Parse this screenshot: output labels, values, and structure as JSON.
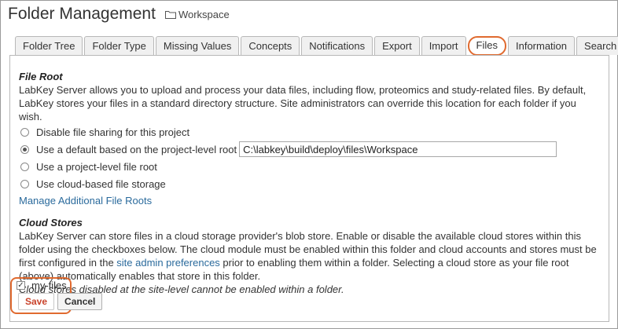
{
  "header": {
    "title": "Folder Management",
    "folder": "Workspace"
  },
  "tabs": [
    {
      "label": "Folder Tree"
    },
    {
      "label": "Folder Type"
    },
    {
      "label": "Missing Values"
    },
    {
      "label": "Concepts"
    },
    {
      "label": "Notifications"
    },
    {
      "label": "Export"
    },
    {
      "label": "Import"
    },
    {
      "label": "Files",
      "active": true
    },
    {
      "label": "Information"
    },
    {
      "label": "Search"
    }
  ],
  "file_root": {
    "title": "File Root",
    "description": "LabKey Server allows you to upload and process your data files, including flow, proteomics and study-related files. By default, LabKey stores your files in a standard directory structure. Site administrators can override this location for each folder if you wish.",
    "options": [
      {
        "label": "Disable file sharing for this project",
        "checked": false
      },
      {
        "label": "Use a default based on the project-level root",
        "checked": true
      },
      {
        "label": "Use a project-level file root",
        "checked": false
      },
      {
        "label": "Use cloud-based file storage",
        "checked": false
      }
    ],
    "default_path": "C:\\labkey\\build\\deploy\\files\\Workspace",
    "manage_link": "Manage Additional File Roots"
  },
  "cloud_stores": {
    "title": "Cloud Stores",
    "desc_part1": "LabKey Server can store files in a cloud storage provider's blob store. Enable or disable the available cloud stores within this folder using the checkboxes below. The cloud module must be enabled within this folder and cloud accounts and stores must be first configured in the ",
    "desc_link": "site admin preferences",
    "desc_part2": " prior to enabling them within a folder. Selecting a cloud store as your file root (above) automatically enables that store in this folder.",
    "note": "Cloud stores disabled at the site-level cannot be enabled within a folder.",
    "store_name": "my-files",
    "store_checked": true
  },
  "buttons": {
    "save": "Save",
    "cancel": "Cancel"
  },
  "colors": {
    "highlight": "#e06a2f",
    "link": "#2a6a9c"
  }
}
